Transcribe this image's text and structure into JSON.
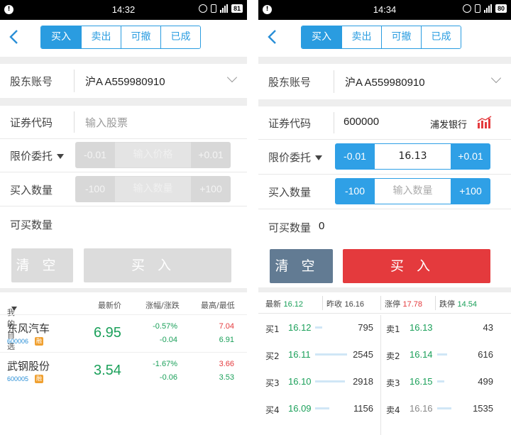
{
  "left": {
    "status": {
      "time": "14:32",
      "battery": "81"
    },
    "tabs": [
      {
        "label": "买入",
        "active": true
      },
      {
        "label": "卖出",
        "active": false
      },
      {
        "label": "可撤",
        "active": false
      },
      {
        "label": "已成",
        "active": false
      }
    ],
    "account": {
      "label": "股东账号",
      "value": "沪A A559980910"
    },
    "code": {
      "label": "证券代码",
      "placeholder": "输入股票"
    },
    "price": {
      "label": "限价委托",
      "minus": "-0.01",
      "placeholder": "输入价格",
      "plus": "+0.01"
    },
    "qty": {
      "label": "买入数量",
      "minus": "-100",
      "placeholder": "输入数量",
      "plus": "+100"
    },
    "available": {
      "label": "可买数量"
    },
    "buttons": {
      "clear": "清空",
      "buy": "买入"
    },
    "watchlist": {
      "headers": {
        "mine": "我的自选",
        "last": "最新价",
        "change": "涨幅/涨跌",
        "hilo": "最高/最低"
      },
      "rows": [
        {
          "name": "东风汽车",
          "code": "600006",
          "badge": "融",
          "price": "6.95",
          "pct": "-0.57%",
          "chg": "-0.04",
          "high": "7.04",
          "low": "6.91"
        },
        {
          "name": "武钢股份",
          "code": "600005",
          "badge": "融",
          "price": "3.54",
          "pct": "-1.67%",
          "chg": "-0.06",
          "high": "3.66",
          "low": "3.53"
        }
      ]
    }
  },
  "right": {
    "status": {
      "time": "14:34",
      "battery": "80"
    },
    "tabs": [
      {
        "label": "买入",
        "active": true
      },
      {
        "label": "卖出",
        "active": false
      },
      {
        "label": "可撤",
        "active": false
      },
      {
        "label": "已成",
        "active": false
      }
    ],
    "account": {
      "label": "股东账号",
      "value": "沪A A559980910"
    },
    "code": {
      "label": "证券代码",
      "value": "600000",
      "stock_name": "浦发银行"
    },
    "price": {
      "label": "限价委托",
      "minus": "-0.01",
      "value": "16.13",
      "plus": "+0.01"
    },
    "qty": {
      "label": "买入数量",
      "minus": "-100",
      "placeholder": "输入数量",
      "plus": "+100"
    },
    "available": {
      "label": "可买数量",
      "value": "0"
    },
    "buttons": {
      "clear": "清空",
      "buy": "买入"
    },
    "quote": {
      "last_label": "最新",
      "last": "16.12",
      "prev_label": "昨收",
      "prev": "16.16",
      "limit_up_label": "涨停",
      "limit_up": "17.78",
      "limit_down_label": "跌停",
      "limit_down": "14.54"
    },
    "orderbook": {
      "bids": [
        {
          "label": "买1",
          "price": "16.12",
          "vol": "795"
        },
        {
          "label": "买2",
          "price": "16.11",
          "vol": "2545"
        },
        {
          "label": "买3",
          "price": "16.10",
          "vol": "2918"
        },
        {
          "label": "买4",
          "price": "16.09",
          "vol": "1156"
        }
      ],
      "asks": [
        {
          "label": "卖1",
          "price": "16.13",
          "vol": "43"
        },
        {
          "label": "卖2",
          "price": "16.14",
          "vol": "616"
        },
        {
          "label": "卖3",
          "price": "16.15",
          "vol": "499"
        },
        {
          "label": "卖4",
          "price": "16.16",
          "vol": "1535"
        }
      ]
    }
  },
  "colors": {
    "accent": "#2a9ce0",
    "buy_red": "#e43a3d",
    "clear_gray_blue": "#627b93",
    "down_green": "#1ba05a"
  }
}
